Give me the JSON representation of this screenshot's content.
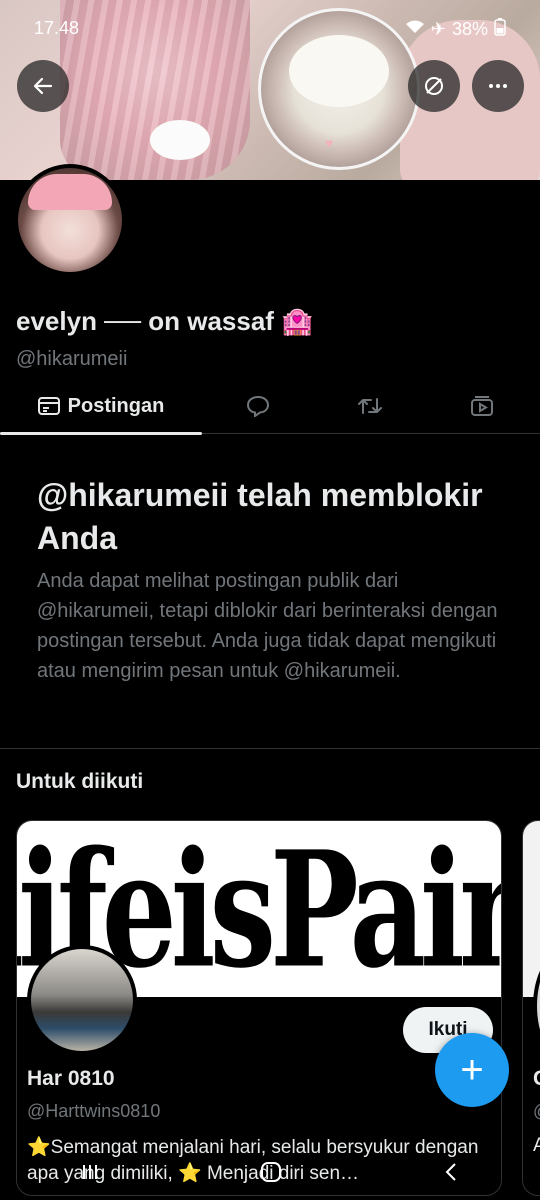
{
  "status_bar": {
    "time": "17.48",
    "battery": "38%"
  },
  "header": {
    "back_icon": "arrow-left-icon",
    "mute_icon": "bell-off-icon",
    "more_icon": "more-horizontal-icon"
  },
  "profile": {
    "name": "evelyn ── on wassaf 🏩",
    "handle": "@hikarumeii"
  },
  "tabs": [
    {
      "label": "Postingan",
      "icon": "posts-icon"
    },
    {
      "label": "",
      "icon": "reply-icon"
    },
    {
      "label": "",
      "icon": "repost-icon"
    },
    {
      "label": "",
      "icon": "media-icon"
    }
  ],
  "blocked_notice": {
    "title": "@hikarumeii telah memblokir Anda",
    "body": "Anda dapat melihat postingan publik dari @hikarumeii, tetapi diblokir dari berinteraksi dengan postingan tersebut. Anda juga tidak dapat mengikuti atau mengirim pesan untuk @hikarumeii."
  },
  "suggestions": {
    "title": "Untuk diikuti",
    "cards": [
      {
        "cover_text": "lifeisPain",
        "follow_label": "Ikuti",
        "name": "Har 0810",
        "handle": "@Harttwins0810",
        "bio": "⭐Semangat menjalani hari, selalu bersyukur dengan apa yang dimiliki, ⭐ Menjadi diri sen…"
      },
      {
        "name": "C",
        "handle": "@",
        "bio": "A"
      }
    ]
  },
  "fab": {
    "label": "+"
  },
  "colors": {
    "accent": "#1d9bf0",
    "background": "#000000",
    "secondary_text": "#71767b"
  }
}
